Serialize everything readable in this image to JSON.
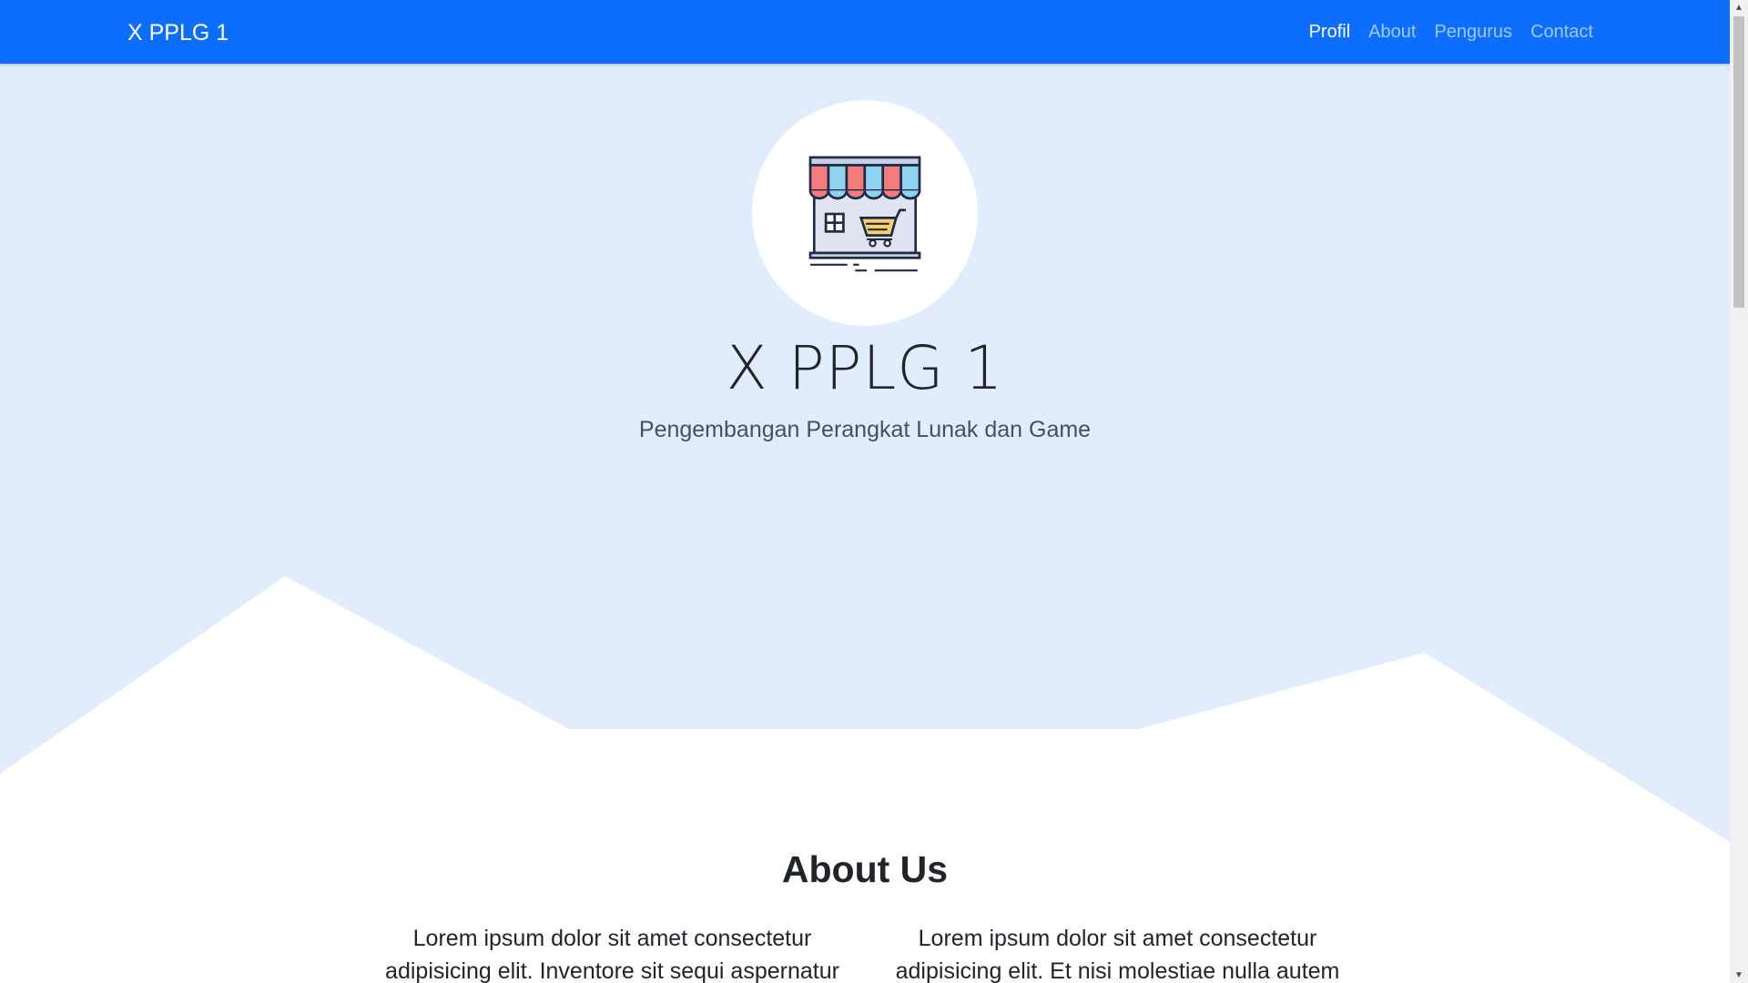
{
  "navbar": {
    "brand": "X PPLG 1",
    "links": [
      {
        "label": "Profil",
        "active": true
      },
      {
        "label": "About",
        "active": false
      },
      {
        "label": "Pengurus",
        "active": false
      },
      {
        "label": "Contact",
        "active": false
      }
    ]
  },
  "hero": {
    "title": "X PPLG 1",
    "subtitle": "Pengembangan Perangkat Lunak dan Game",
    "avatar_icon": "storefront-icon"
  },
  "about": {
    "title": "About Us",
    "columns": [
      "Lorem ipsum dolor sit amet consectetur adipisicing elit. Inventore sit sequi aspernatur",
      "Lorem ipsum dolor sit amet consectetur adipisicing elit. Et nisi molestiae nulla autem"
    ]
  },
  "colors": {
    "navbar": "#0d6efd",
    "hero_background": "#e1ecfd",
    "awning_red": "#f47b7b",
    "awning_blue": "#8fd2ef",
    "cart_yellow": "#f8cf6a"
  }
}
